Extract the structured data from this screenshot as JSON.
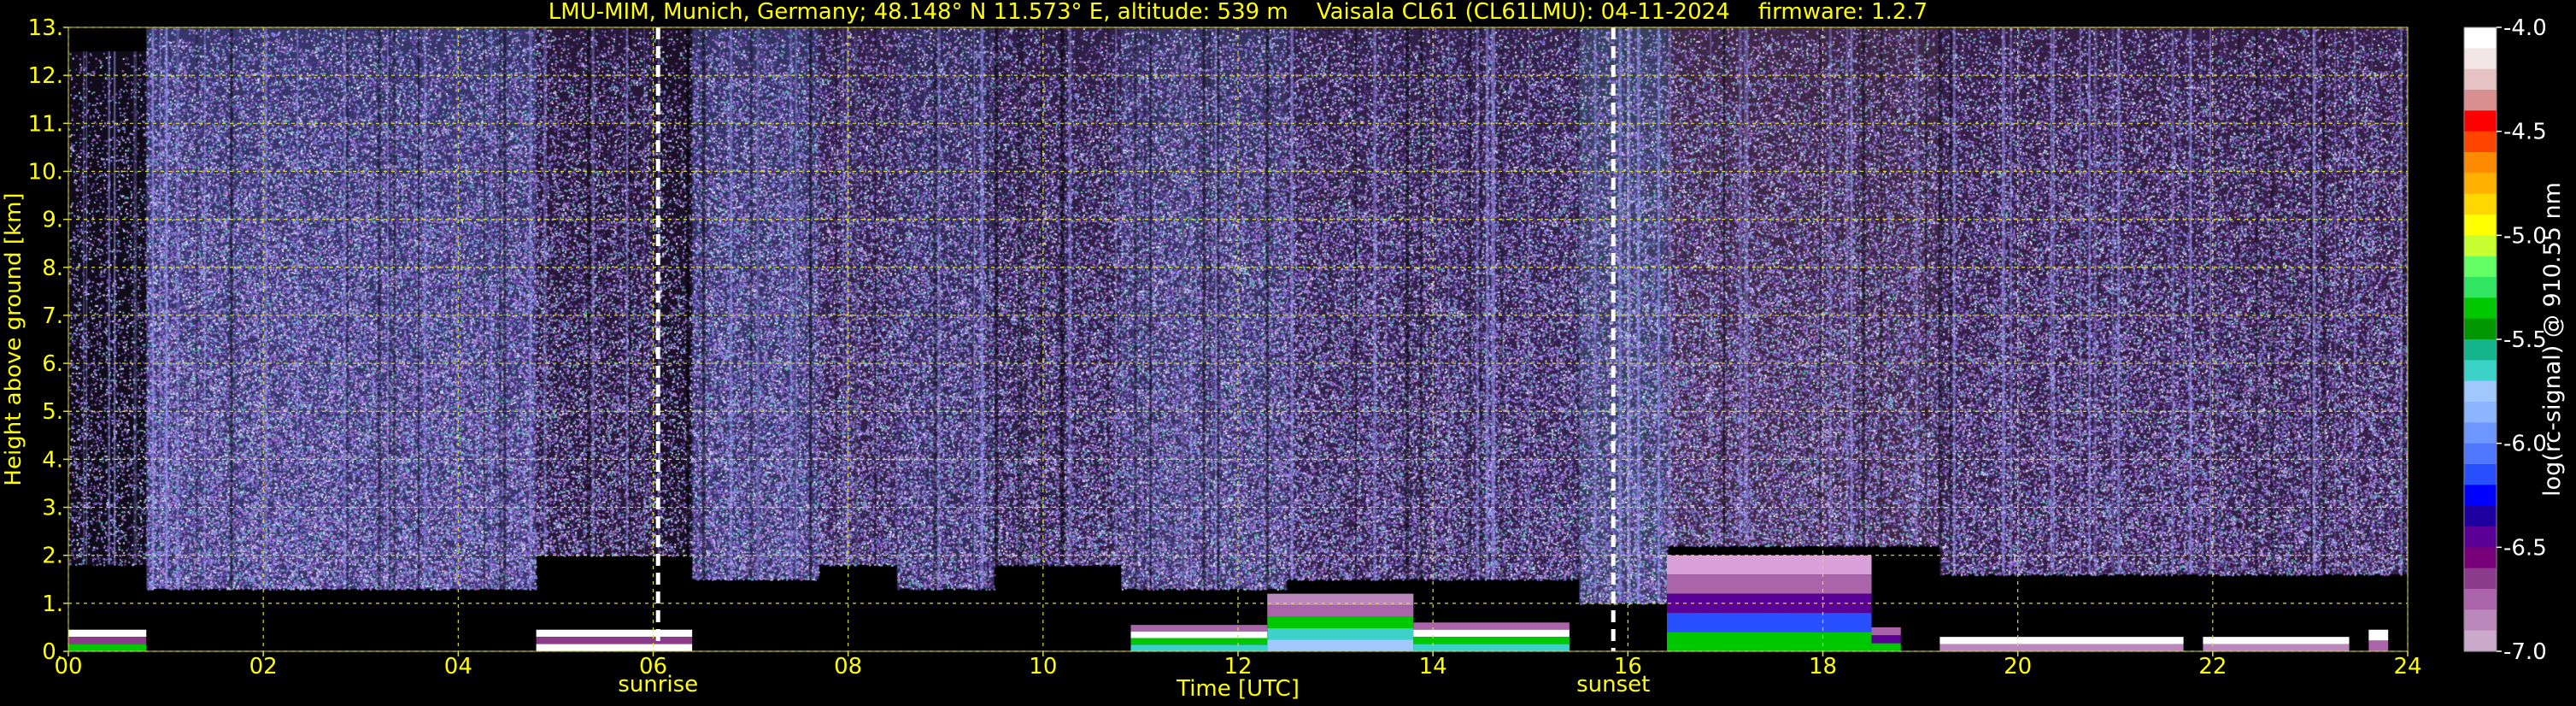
{
  "chart_data": {
    "type": "heatmap",
    "title": "LMU-MIM, Munich, Germany; 48.148° N 11.573° E, altitude: 539 m    Vaisala CL61 (CL61LMU): 04-11-2024    firmware: 1.2.7",
    "xlabel": "Time [UTC]",
    "ylabel": "Height above ground [km]",
    "xlim": [
      0,
      24
    ],
    "ylim": [
      0,
      13
    ],
    "x_ticks": [
      "00",
      "02",
      "04",
      "06",
      "08",
      "10",
      "12",
      "14",
      "16",
      "18",
      "20",
      "22",
      "24"
    ],
    "y_ticks": [
      "0.",
      "1.",
      "2.",
      "3.",
      "4.",
      "5.",
      "6.",
      "7.",
      "8.",
      "9.",
      "10.",
      "11.",
      "12.",
      "13."
    ],
    "grid": true,
    "colorbar": {
      "label": "log(rc-signal) @ 910.55 nm",
      "range": [
        -7.0,
        -4.0
      ],
      "ticks": [
        "-4.0",
        "-4.5",
        "-5.0",
        "-5.5",
        "-6.0",
        "-6.5",
        "-7.0"
      ],
      "colors": [
        "#ffffff",
        "#f2e6e6",
        "#e6c4c4",
        "#d99090",
        "#ff0000",
        "#ff4500",
        "#ff8c00",
        "#ffb000",
        "#ffd700",
        "#ffff00",
        "#c8ff32",
        "#64ff64",
        "#32e664",
        "#00c800",
        "#009600",
        "#14b48c",
        "#3cd2c8",
        "#a0c8ff",
        "#8cb4ff",
        "#6e96ff",
        "#5078ff",
        "#2850ff",
        "#0000ff",
        "#1e00a0",
        "#5a0096",
        "#780078",
        "#8c3c8c",
        "#aa64aa",
        "#bb88bb",
        "#ccaacc"
      ]
    },
    "annotations": [
      {
        "text": "sunrise",
        "x": 6.05
      },
      {
        "text": "sunset",
        "x": 15.85
      }
    ],
    "noise_segments": [
      {
        "x0": 0.0,
        "x1": 0.8,
        "top": 12.5,
        "bottom": 1.8,
        "density": 0.3,
        "tint": "#6a4a9a"
      },
      {
        "x0": 0.8,
        "x1": 4.8,
        "top": 13.0,
        "bottom": 1.3,
        "density": 0.95,
        "tint": "#6868c8"
      },
      {
        "x0": 4.8,
        "x1": 6.0,
        "top": 13.0,
        "bottom": 2.0,
        "density": 0.6,
        "tint": "#7a4aa8"
      },
      {
        "x0": 6.0,
        "x1": 6.4,
        "top": 13.0,
        "bottom": 2.0,
        "density": 0.4,
        "tint": "#7a4aa8"
      },
      {
        "x0": 6.4,
        "x1": 7.7,
        "top": 13.0,
        "bottom": 1.5,
        "density": 0.9,
        "tint": "#6a6ac8"
      },
      {
        "x0": 7.7,
        "x1": 8.5,
        "top": 13.0,
        "bottom": 1.8,
        "density": 0.75,
        "tint": "#7a50b0"
      },
      {
        "x0": 8.5,
        "x1": 9.5,
        "top": 13.0,
        "bottom": 1.3,
        "density": 0.8,
        "tint": "#7060c0"
      },
      {
        "x0": 9.5,
        "x1": 10.8,
        "top": 13.0,
        "bottom": 1.8,
        "density": 0.7,
        "tint": "#7a50b0"
      },
      {
        "x0": 10.8,
        "x1": 12.5,
        "top": 13.0,
        "bottom": 1.3,
        "density": 0.9,
        "tint": "#7068c0"
      },
      {
        "x0": 12.5,
        "x1": 15.5,
        "top": 13.0,
        "bottom": 1.5,
        "density": 0.75,
        "tint": "#7a50b0"
      },
      {
        "x0": 15.5,
        "x1": 16.4,
        "top": 13.0,
        "bottom": 1.0,
        "density": 0.8,
        "tint": "#8090d8"
      },
      {
        "x0": 16.4,
        "x1": 19.2,
        "top": 13.0,
        "bottom": 2.2,
        "density": 0.75,
        "tint": "#9a60a8"
      },
      {
        "x0": 19.2,
        "x1": 21.8,
        "top": 13.0,
        "bottom": 1.6,
        "density": 0.7,
        "tint": "#8a50b0"
      },
      {
        "x0": 21.8,
        "x1": 24.0,
        "top": 13.0,
        "bottom": 1.6,
        "density": 0.7,
        "tint": "#8a50b0"
      }
    ],
    "boundary_layer": [
      {
        "x0": 0.0,
        "x1": 0.8,
        "top": 0.45,
        "colors": [
          "#ffffff",
          "#8a3c8a",
          "#00c800"
        ]
      },
      {
        "x0": 4.8,
        "x1": 6.4,
        "top": 0.45,
        "colors": [
          "#ffffff",
          "#8a3c8a",
          "#ffffff"
        ]
      },
      {
        "x0": 10.9,
        "x1": 12.3,
        "top": 0.55,
        "colors": [
          "#aa64aa",
          "#ffffff",
          "#00c800",
          "#3cd2c8"
        ]
      },
      {
        "x0": 12.3,
        "x1": 13.8,
        "top": 1.2,
        "colors": [
          "#bb88bb",
          "#aa64aa",
          "#00c800",
          "#3cd2c8",
          "#a0c8ff"
        ]
      },
      {
        "x0": 13.8,
        "x1": 15.4,
        "top": 0.6,
        "colors": [
          "#aa64aa",
          "#ffffff",
          "#00c800",
          "#3cd2c8"
        ]
      },
      {
        "x0": 16.4,
        "x1": 18.5,
        "top": 2.0,
        "colors": [
          "#d9a0d9",
          "#aa64aa",
          "#5a0096",
          "#2850ff",
          "#00c800"
        ]
      },
      {
        "x0": 18.5,
        "x1": 18.8,
        "top": 0.5,
        "colors": [
          "#aa64aa",
          "#5a0096",
          "#00c800"
        ]
      },
      {
        "x0": 19.2,
        "x1": 21.7,
        "top": 0.3,
        "colors": [
          "#ffffff",
          "#bb88bb"
        ]
      },
      {
        "x0": 21.9,
        "x1": 23.4,
        "top": 0.3,
        "colors": [
          "#ffffff",
          "#bb88bb"
        ]
      },
      {
        "x0": 23.6,
        "x1": 23.8,
        "top": 0.45,
        "colors": [
          "#ffffff",
          "#aa64aa"
        ]
      }
    ]
  }
}
